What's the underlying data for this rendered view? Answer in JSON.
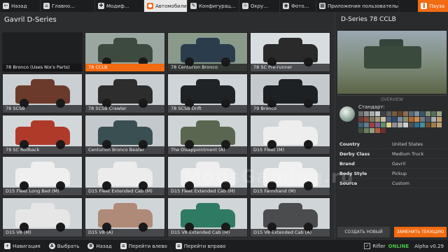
{
  "topbar": {
    "tabs": [
      {
        "label": "Назад",
        "icon": "back-icon",
        "glyph": "←"
      },
      {
        "label": "Главно...",
        "icon": "home-icon",
        "glyph": "⌂"
      },
      {
        "label": "Модиф...",
        "icon": "puzzle-icon",
        "glyph": "✚"
      },
      {
        "label": "Автомобили",
        "icon": "car-icon",
        "glyph": "●"
      },
      {
        "label": "Конфигурац...",
        "icon": "wrench-icon",
        "glyph": "✎"
      },
      {
        "label": "Окру...",
        "icon": "environment-icon",
        "glyph": "☼"
      },
      {
        "label": "Фото...",
        "icon": "camera-icon",
        "glyph": "◉"
      },
      {
        "label": "Приложения пользовательс...",
        "icon": "apps-icon",
        "glyph": "▦"
      }
    ],
    "pause_label": "Пауза",
    "pause_icon": "pause-icon",
    "pause_glyph": "❚"
  },
  "left": {
    "title": "Gavril D-Series"
  },
  "configs": [
    {
      "label": "78 Bronco (Uses Nix's Parts)",
      "color": "#1e1f21",
      "body": "#1e1f21",
      "selected": false
    },
    {
      "label": "78 CCLB",
      "color": "#9aa7a0",
      "body": "#3d4a3f",
      "selected": true
    },
    {
      "label": "78 Centurion Bronco",
      "color": "#8a9a8a",
      "body": "#2b3d4d",
      "selected": false
    },
    {
      "label": "78 SC Pre-runner",
      "color": "#d8dde0",
      "body": "#2a2a2a",
      "selected": false
    },
    {
      "label": "78 SCSB",
      "color": "#c9cfd3",
      "body": "#6b3a2a",
      "selected": false
    },
    {
      "label": "78 SCSB Crawler",
      "color": "#c7cdd1",
      "body": "#2d2d2d",
      "selected": false
    },
    {
      "label": "78 SCSB Drift",
      "color": "#cfd4d8",
      "body": "#1f2326",
      "selected": false
    },
    {
      "label": "79 Bronco",
      "color": "#c3c9cd",
      "body": "#1e2124",
      "selected": false
    },
    {
      "label": "79 SC Rollback",
      "color": "#d2d7da",
      "body": "#b03a2a",
      "selected": false
    },
    {
      "label": "Centurion Bronco Beater",
      "color": "#c2c8cc",
      "body": "#3a4f52",
      "selected": false
    },
    {
      "label": "The Disappointment (A)",
      "color": "#cfd4d7",
      "body": "#5b6651",
      "selected": false
    },
    {
      "label": "D15 Fleet (M)",
      "color": "#d0d5d8",
      "body": "#eeeeee",
      "selected": false
    },
    {
      "label": "D15 Fleet Long Bed (M)",
      "color": "#d0d5d8",
      "body": "#efefef",
      "selected": false
    },
    {
      "label": "D15 Fleet Extended Cab (M)",
      "color": "#d0d5d8",
      "body": "#ececec",
      "selected": false
    },
    {
      "label": "D15 Fleet Extended Cab (M)",
      "color": "#d0d5d8",
      "body": "#efefef",
      "selected": false
    },
    {
      "label": "D15 Farmhand (M)",
      "color": "#d0d5d8",
      "body": "#f1f1f1",
      "selected": false
    },
    {
      "label": "D15 V8 (M)",
      "color": "#d0d5d8",
      "body": "#e6e6e6",
      "selected": false
    },
    {
      "label": "D15 V8 (A)",
      "color": "#d0d5d8",
      "body": "#b08a78",
      "selected": false
    },
    {
      "label": "D15 V8 Extended Cab (M)",
      "color": "#d0d5d8",
      "body": "#2f7a62",
      "selected": false
    },
    {
      "label": "D15 V8 Extended Cab (A)",
      "color": "#d0d5d8",
      "body": "#4a4c4e",
      "selected": false
    }
  ],
  "right": {
    "title": "D-Series 78 CCLB",
    "overview_label": "OVERVIEW",
    "paint_label": "Стандарт:",
    "swatches": [
      "#6b6f72",
      "#8e9194",
      "#a9acaf",
      "#c4c6c8",
      "#3e4246",
      "#5c6063",
      "#7a5a3f",
      "#5e4633",
      "#8f6d4a",
      "#5b6c7a",
      "#7d8f9c",
      "#3b5466",
      "#7e8f76",
      "#5b6f5b",
      "#9aa687",
      "#6b3b32",
      "#8a4b3d",
      "#7a7a64",
      "#a79a7c",
      "#c9c1a6",
      "#4c5f7a",
      "#2f4a6b",
      "#7a8aa3",
      "#8a8f6a",
      "#b06a3a",
      "#d08a4a",
      "#6f7a84",
      "#4f5a64",
      "#a7b0b8",
      "#c8a070",
      "#3f6070",
      "#5f7f8f",
      "#9f3f3f",
      "#7f5f8f",
      "#5f8f6f",
      "#dfcf8f",
      "#8f8f8f",
      "#afafaf",
      "#cfcfcf",
      "#4f4f4f",
      "#2f6f8f",
      "#3f8f9f",
      "#6f4f2f",
      "#9f7f4f",
      "#bf9f6f",
      "#3f4f3f",
      "#6f7f5f",
      "#8f9f7f",
      "#af5f3f",
      "#6f2f2f"
    ],
    "info": [
      {
        "key": "Country",
        "value": "United States"
      },
      {
        "key": "Derby Class",
        "value": "Medium Truck"
      },
      {
        "key": "Brand",
        "value": "Gavril"
      },
      {
        "key": "Body Style",
        "value": "Pickup"
      },
      {
        "key": "Source",
        "value": "Custom"
      }
    ],
    "create_label": "СОЗДАТЬ НОВЫЙ",
    "replace_label": "ЗАМЕНИТЬ ТЕКУЩУЮ"
  },
  "bottombar": {
    "hints": [
      {
        "key": "+",
        "label": "Навигация",
        "shape": "sq"
      },
      {
        "key": "A",
        "label": "Выбрать",
        "shape": "round"
      },
      {
        "key": "B",
        "label": "Назад",
        "shape": "round"
      },
      {
        "key": "≡",
        "label": "Перейти влево",
        "shape": "sq"
      },
      {
        "key": "≡",
        "label": "Перейти вправо",
        "shape": "sq"
      }
    ],
    "username": "Rifler",
    "online_label": "ONLINE",
    "version": "Alpha v0.29"
  },
  "watermark": "ModsGaming.ru"
}
